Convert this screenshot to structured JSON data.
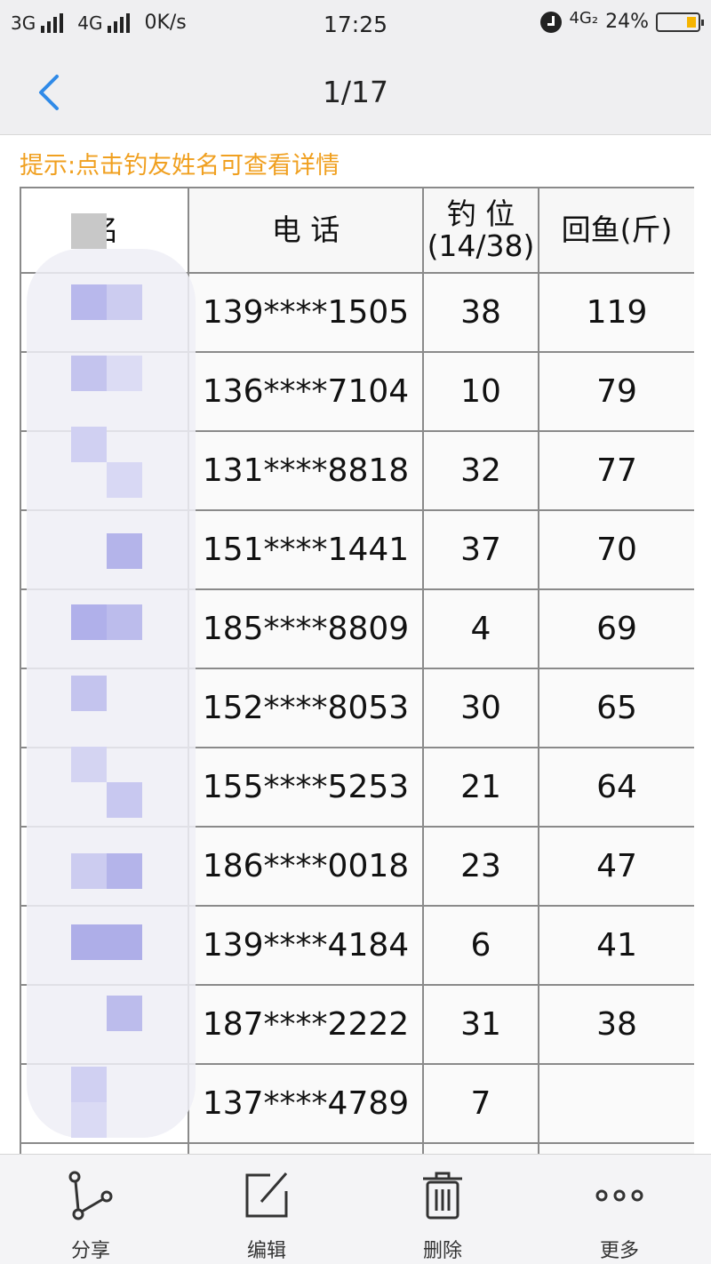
{
  "status_bar": {
    "net1": "3G",
    "net2": "4G",
    "speed": "0K/s",
    "time": "17:25",
    "net3": "4G₂",
    "battery": "24%",
    "battery_color": "#f5b400"
  },
  "nav": {
    "title": "1/17",
    "back_icon": "chevron-left-icon",
    "accent": "#2f8ae8"
  },
  "tip": "提示:点击钓友姓名可查看详情",
  "table": {
    "headers": {
      "name": "名",
      "phone": "电 话",
      "spot": "钓 位",
      "spot_count": "(14/38)",
      "catch": "回鱼(斤)"
    },
    "rows": [
      {
        "phone": "139****1505",
        "spot": "38",
        "catch": "119"
      },
      {
        "phone": "136****7104",
        "spot": "10",
        "catch": "79"
      },
      {
        "phone": "131****8818",
        "spot": "32",
        "catch": "77"
      },
      {
        "phone": "151****1441",
        "spot": "37",
        "catch": "70"
      },
      {
        "phone": "185****8809",
        "spot": "4",
        "catch": "69"
      },
      {
        "phone": "152****8053",
        "spot": "30",
        "catch": "65"
      },
      {
        "phone": "155****5253",
        "spot": "21",
        "catch": "64"
      },
      {
        "phone": "186****0018",
        "spot": "23",
        "catch": "47"
      },
      {
        "phone": "139****4184",
        "spot": "6",
        "catch": "41"
      },
      {
        "phone": "187****2222",
        "spot": "31",
        "catch": "38"
      },
      {
        "phone": "137****4789",
        "spot": "7",
        "catch": ""
      },
      {
        "phone": "",
        "spot": "",
        "catch": ""
      }
    ]
  },
  "toolbar": {
    "share": "分享",
    "edit": "编辑",
    "delete": "删除",
    "more": "更多"
  }
}
